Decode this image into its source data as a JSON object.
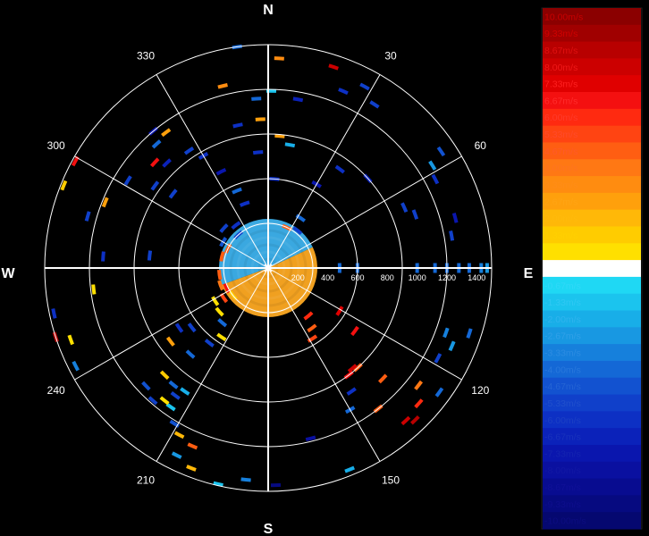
{
  "chart_data": {
    "type": "polar-radar",
    "compass": {
      "north": "N",
      "east": "E",
      "south": "S",
      "west": "W"
    },
    "bearing_labels": [
      "30",
      "60",
      "120",
      "150",
      "210",
      "240",
      "300",
      "330"
    ],
    "range_labels": [
      "200",
      "400",
      "600",
      "800",
      "1000",
      "1200",
      "1400"
    ],
    "max_range": 1500,
    "colorbar": {
      "unit": "m/s",
      "min": -10.0,
      "max": 10.0,
      "labels": [
        "10.00m/s",
        "9.33m/s",
        "8.67m/s",
        "8.00m/s",
        "7.33m/s",
        "6.67m/s",
        "6.00m/s",
        "5.33m/s",
        "4.67m/s",
        "4.00m/s",
        "3.33m/s",
        "2.67m/s",
        "2.00m/s",
        "1.33m/s",
        "0.67m/s",
        "0.00m/s",
        "-0.67m/s",
        "-1.33m/s",
        "-2.00m/s",
        "-2.67m/s",
        "-3.33m/s",
        "-4.00m/s",
        "-4.67m/s",
        "-5.33m/s",
        "-6.00m/s",
        "-6.67m/s",
        "-7.33m/s",
        "-8.00m/s",
        "-8.67m/s",
        "-9.33m/s",
        "-10.00m/s"
      ],
      "colors": [
        "#8b0000",
        "#a00000",
        "#b80000",
        "#cc0000",
        "#e00000",
        "#f41010",
        "#ff2a10",
        "#ff4412",
        "#ff5e12",
        "#ff7814",
        "#ff8c10",
        "#ffa00c",
        "#ffb808",
        "#ffcc00",
        "#ffe000",
        "#ffffff",
        "#1fd8f4",
        "#1bc4ee",
        "#18aee8",
        "#1898e2",
        "#1680dc",
        "#1468d6",
        "#1252d0",
        "#1040ca",
        "#0d30c4",
        "#0b22ba",
        "#0a16ae",
        "#0a10a0",
        "#080c90",
        "#060a80",
        "#050870"
      ],
      "label_colors": [
        "#c80000",
        "#d00000",
        "#e01010",
        "#f01818",
        "#ff2020",
        "#ff2c2c",
        "#ff3a2a",
        "#ff4a2a",
        "#ff5a28",
        "#ff7420",
        "#ff8c18",
        "#ffa414",
        "#ffba0c",
        "#ffd000",
        "#ffe000",
        "#ffffff",
        "#30d8f8",
        "#30c8f4",
        "#30b4ee",
        "#30a0e8",
        "#2c8ce2",
        "#2878dc",
        "#2464d4",
        "#2050cc",
        "#1c40c4",
        "#1832bc",
        "#1424b0",
        "#1218a4",
        "#101098",
        "#0e0e8c",
        "#0c0c80"
      ]
    },
    "near_field": {
      "approaching_color": "#3aa8e0",
      "receding_color": "#f0a020"
    },
    "echoes": [
      {
        "az": 3,
        "r": 1410,
        "v": 3.5
      },
      {
        "az": 1,
        "r": 1190,
        "v": -1.5
      },
      {
        "az": 5,
        "r": 890,
        "v": 3.0
      },
      {
        "az": 10,
        "r": 1150,
        "v": -6.5
      },
      {
        "az": 10,
        "r": 840,
        "v": -2.0
      },
      {
        "az": 4,
        "r": 600,
        "v": -6.0
      },
      {
        "az": 18,
        "r": 1420,
        "v": 8.0
      },
      {
        "az": 23,
        "r": 1290,
        "v": -6.0
      },
      {
        "az": 28,
        "r": 1380,
        "v": -5.5
      },
      {
        "az": 33,
        "r": 1310,
        "v": -5.0
      },
      {
        "az": 30,
        "r": 650,
        "v": -7.0
      },
      {
        "az": 36,
        "r": 820,
        "v": -6.0
      },
      {
        "az": 48,
        "r": 900,
        "v": -6.5
      },
      {
        "az": 56,
        "r": 1400,
        "v": -4.5
      },
      {
        "az": 58,
        "r": 1300,
        "v": -2.5
      },
      {
        "az": 62,
        "r": 1270,
        "v": -6.0
      },
      {
        "az": 70,
        "r": 1050,
        "v": -5.0
      },
      {
        "az": 75,
        "r": 1300,
        "v": -7.5
      },
      {
        "az": 66,
        "r": 1000,
        "v": -5.5
      },
      {
        "az": 80,
        "r": 1250,
        "v": -5.5
      },
      {
        "az": 90,
        "r": 1000,
        "v": -4.0
      },
      {
        "az": 90,
        "r": 1120,
        "v": -4.0
      },
      {
        "az": 90,
        "r": 1200,
        "v": -4.0
      },
      {
        "az": 90,
        "r": 1280,
        "v": -4.0
      },
      {
        "az": 90,
        "r": 1350,
        "v": -4.0
      },
      {
        "az": 90,
        "r": 1430,
        "v": -3.0
      },
      {
        "az": 90,
        "r": 1470,
        "v": -2.5
      },
      {
        "az": 90,
        "r": 480,
        "v": -4.0
      },
      {
        "az": 90,
        "r": 600,
        "v": -4.0
      },
      {
        "az": 108,
        "r": 1420,
        "v": -4.0
      },
      {
        "az": 110,
        "r": 1270,
        "v": -3.5
      },
      {
        "az": 113,
        "r": 1340,
        "v": -2.5
      },
      {
        "az": 118,
        "r": 1290,
        "v": -5.0
      },
      {
        "az": 126,
        "r": 1420,
        "v": -4.0
      },
      {
        "az": 128,
        "r": 1280,
        "v": 4.0
      },
      {
        "az": 132,
        "r": 1360,
        "v": 6.0
      },
      {
        "az": 136,
        "r": 1420,
        "v": 9.0
      },
      {
        "az": 138,
        "r": 1380,
        "v": 8.0
      },
      {
        "az": 134,
        "r": 1070,
        "v": 4.5
      },
      {
        "az": 138,
        "r": 900,
        "v": 5.0
      },
      {
        "az": 140,
        "r": 880,
        "v": 8.0
      },
      {
        "az": 143,
        "r": 900,
        "v": 7.0
      },
      {
        "az": 126,
        "r": 720,
        "v": 7.0
      },
      {
        "az": 121,
        "r": 560,
        "v": 7.5
      },
      {
        "az": 142,
        "r": 1200,
        "v": 4.5
      },
      {
        "az": 146,
        "r": 1000,
        "v": -6.0
      },
      {
        "az": 150,
        "r": 1100,
        "v": -4.0
      },
      {
        "az": 158,
        "r": 1460,
        "v": -2.0
      },
      {
        "az": 166,
        "r": 1180,
        "v": -8.0
      },
      {
        "az": 178,
        "r": 1460,
        "v": -9.0
      },
      {
        "az": 186,
        "r": 1430,
        "v": -3.5
      },
      {
        "az": 193,
        "r": 1490,
        "v": -1.5
      },
      {
        "az": 201,
        "r": 1440,
        "v": 2.0
      },
      {
        "az": 203,
        "r": 1300,
        "v": 4.5
      },
      {
        "az": 206,
        "r": 1400,
        "v": -2.5
      },
      {
        "az": 208,
        "r": 1270,
        "v": 2.0
      },
      {
        "az": 211,
        "r": 1220,
        "v": -4.5
      },
      {
        "az": 215,
        "r": 1140,
        "v": -1.0
      },
      {
        "az": 214,
        "r": 1000,
        "v": -2.0
      },
      {
        "az": 216,
        "r": 1060,
        "v": -5.0
      },
      {
        "az": 218,
        "r": 1130,
        "v": 0.5
      },
      {
        "az": 219,
        "r": 1010,
        "v": -4.0
      },
      {
        "az": 221,
        "r": 1180,
        "v": -5.0
      },
      {
        "az": 224,
        "r": 1000,
        "v": 1.5
      },
      {
        "az": 226,
        "r": 1140,
        "v": -4.5
      },
      {
        "az": 222,
        "r": 780,
        "v": -4.0
      },
      {
        "az": 218,
        "r": 640,
        "v": -5.0
      },
      {
        "az": 214,
        "r": 560,
        "v": 1.0
      },
      {
        "az": 220,
        "r": 480,
        "v": -4.0
      },
      {
        "az": 228,
        "r": 440,
        "v": 1.0
      },
      {
        "az": 232,
        "r": 650,
        "v": -5.0
      },
      {
        "az": 233,
        "r": 820,
        "v": 3.0
      },
      {
        "az": 236,
        "r": 720,
        "v": -6.0
      },
      {
        "az": 243,
        "r": 1450,
        "v": -3.0
      },
      {
        "az": 250,
        "r": 1410,
        "v": 0.8
      },
      {
        "az": 252,
        "r": 1500,
        "v": 9.0
      },
      {
        "az": 263,
        "r": 1180,
        "v": 1.0
      },
      {
        "az": 258,
        "r": 1470,
        "v": -6.0
      },
      {
        "az": 274,
        "r": 1110,
        "v": -6.0
      },
      {
        "az": 276,
        "r": 800,
        "v": -5.5
      },
      {
        "az": 286,
        "r": 1260,
        "v": -5.5
      },
      {
        "az": 292,
        "r": 1180,
        "v": 3.0
      },
      {
        "az": 292,
        "r": 1480,
        "v": 1.5
      },
      {
        "az": 299,
        "r": 1480,
        "v": 7.0
      },
      {
        "az": 302,
        "r": 1110,
        "v": -5.0
      },
      {
        "az": 306,
        "r": 940,
        "v": -5.0
      },
      {
        "az": 308,
        "r": 810,
        "v": -5.5
      },
      {
        "az": 313,
        "r": 1040,
        "v": 6.5
      },
      {
        "az": 316,
        "r": 980,
        "v": -6.5
      },
      {
        "az": 318,
        "r": 1120,
        "v": -4.0
      },
      {
        "az": 320,
        "r": 1200,
        "v": -7.0
      },
      {
        "az": 323,
        "r": 1140,
        "v": 3.0
      },
      {
        "az": 326,
        "r": 950,
        "v": -5.0
      },
      {
        "az": 330,
        "r": 870,
        "v": -6.0
      },
      {
        "az": 334,
        "r": 720,
        "v": -7.0
      },
      {
        "az": 338,
        "r": 560,
        "v": -4.0
      },
      {
        "az": 340,
        "r": 460,
        "v": -6.0
      },
      {
        "az": 346,
        "r": 1260,
        "v": 3.5
      },
      {
        "az": 348,
        "r": 980,
        "v": -6.0
      },
      {
        "az": 352,
        "r": 1500,
        "v": -4.0
      },
      {
        "az": 356,
        "r": 1140,
        "v": -4.0
      },
      {
        "az": 357,
        "r": 1000,
        "v": 3.0
      },
      {
        "az": 355,
        "r": 780,
        "v": -6.0
      },
      {
        "az": 312,
        "r": 400,
        "v": -5.0
      },
      {
        "az": 318,
        "r": 300,
        "v": -5.0
      },
      {
        "az": 323,
        "r": 360,
        "v": -6.0
      },
      {
        "az": 300,
        "r": 350,
        "v": -4.5
      },
      {
        "az": 296,
        "r": 300,
        "v": 5.0
      },
      {
        "az": 284,
        "r": 320,
        "v": 4.5
      },
      {
        "az": 262,
        "r": 330,
        "v": 5.0
      },
      {
        "az": 250,
        "r": 340,
        "v": 4.0
      },
      {
        "az": 244,
        "r": 310,
        "v": 7.0
      },
      {
        "az": 236,
        "r": 360,
        "v": 5.5
      },
      {
        "az": 238,
        "r": 420,
        "v": 1.0
      },
      {
        "az": 232,
        "r": 300,
        "v": 1.5
      },
      {
        "az": 25,
        "r": 300,
        "v": 5.0
      },
      {
        "az": 33,
        "r": 400,
        "v": -4.0
      },
      {
        "az": 38,
        "r": 320,
        "v": -5.0
      },
      {
        "az": 140,
        "r": 420,
        "v": 6.0
      },
      {
        "az": 144,
        "r": 500,
        "v": 4.5
      },
      {
        "az": 148,
        "r": 560,
        "v": 5.5
      }
    ]
  }
}
